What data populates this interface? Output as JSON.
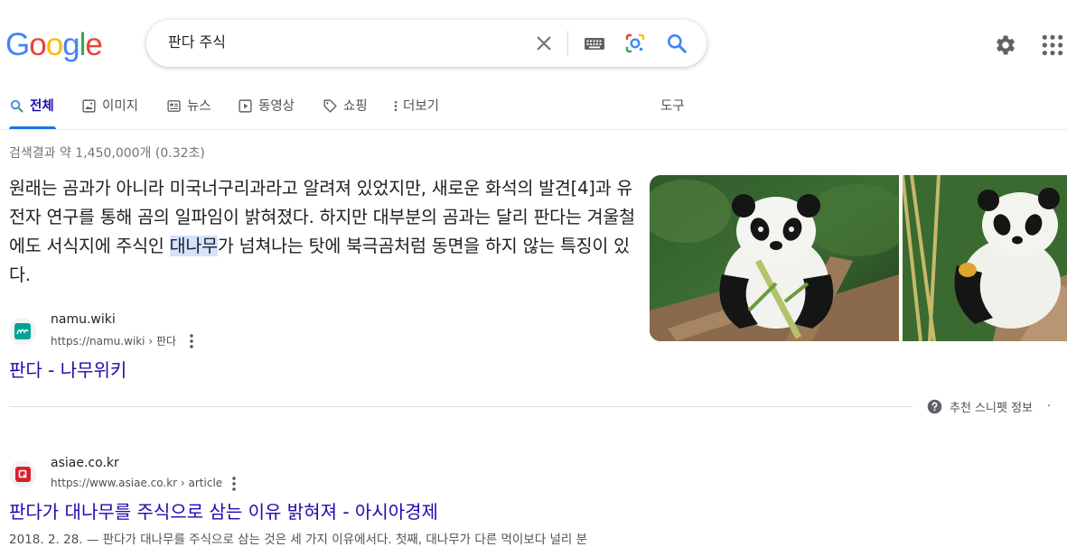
{
  "logo": {
    "letters": [
      "G",
      "o",
      "o",
      "g",
      "l",
      "e"
    ],
    "colors": [
      "#4285F4",
      "#EA4335",
      "#FBBC05",
      "#4285F4",
      "#34A853",
      "#EA4335"
    ]
  },
  "search": {
    "query": "판다 주식"
  },
  "tabs": [
    {
      "label": "전체",
      "icon": "search-icon",
      "active": true
    },
    {
      "label": "이미지",
      "icon": "image-icon"
    },
    {
      "label": "뉴스",
      "icon": "news-icon"
    },
    {
      "label": "동영상",
      "icon": "play-icon"
    },
    {
      "label": "쇼핑",
      "icon": "tag-icon"
    },
    {
      "label": "더보기",
      "icon": "more-vert-icon"
    }
  ],
  "tools_label": "도구",
  "result_stats": "검색결과 약 1,450,000개 (0.32초)",
  "snippet": {
    "before": "원래는 곰과가 아니라 미국너구리과라고 알려져 있었지만, 새로운 화석의 발견[4]과 유전자 연구를 통해 곰의 일파임이 밝혀졌다. 하지만 대부분의 곰과는 달리 판다는 겨울철에도 서식지에 주식인 ",
    "highlight": "대나무",
    "after": "가 넘쳐나는 탓에 북극곰처럼 동면을 하지 않는 특징이 있다."
  },
  "featured_result": {
    "site": "namu.wiki",
    "url": "https://namu.wiki › 판다",
    "title": "판다 - 나무위키",
    "favicon_color": "#00a495"
  },
  "featured_info": {
    "label": "추천 스니펫 정보",
    "dot": "·"
  },
  "result2": {
    "site": "asiae.co.kr",
    "url": "https://www.asiae.co.kr › article",
    "title": "판다가 대나무를 주식으로 삼는 이유 밝혀져 - 아시아경제",
    "favicon_color": "#d7202a"
  },
  "result2_snippet": "2018. 2. 28. — 판다가 대나무를 주식으로 삼는 것은 세 가지 이유에서다. 첫째, 대나무가 다른 먹이보다 널리 분"
}
